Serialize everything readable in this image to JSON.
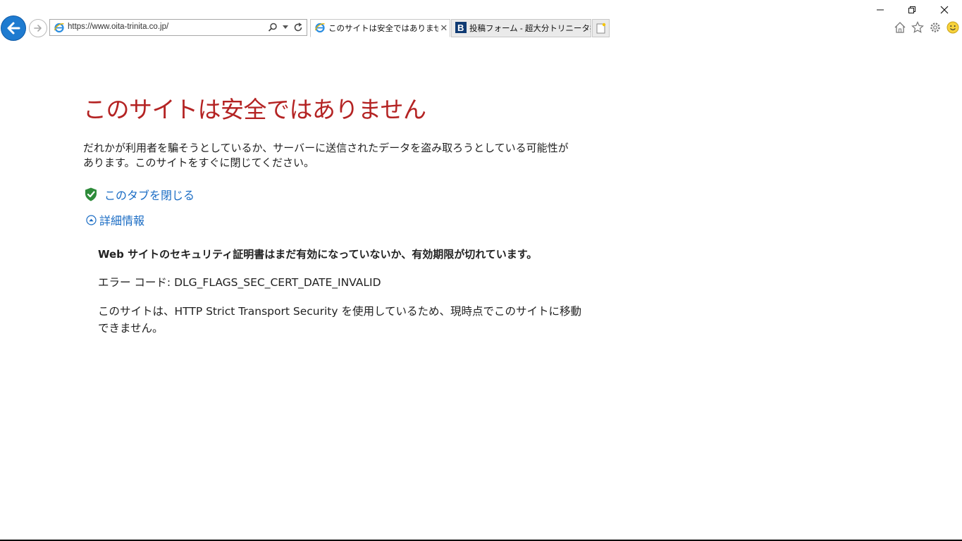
{
  "browser": {
    "address": {
      "url": "https://www.oita-trinita.co.jp/"
    },
    "tabs": [
      {
        "label": "このサイトは安全ではありません",
        "active": true,
        "favicon": "ie-icon"
      },
      {
        "label": "投稿フォーム - 超大分トリニータ掲...",
        "active": false,
        "favicon": "b-favicon"
      }
    ],
    "close_tab_glyph": "✕",
    "accent_color": "#1e7bd0"
  },
  "page": {
    "title": "このサイトは安全ではありません",
    "description": "だれかが利用者を騙そうとしているか、サーバーに送信されたデータを盗み取ろうとしている可能性があります。このサイトをすぐに閉じてください。",
    "close_tab_link": "このタブを閉じる",
    "details_toggle": "詳細情報",
    "details": {
      "headline": "Web サイトのセキュリティ証明書はまだ有効になっていないか、有効期限が切れています。",
      "error_code": "エラー コード: DLG_FLAGS_SEC_CERT_DATE_INVALID",
      "hsts_note": "このサイトは、HTTP Strict Transport Security を使用しているため、現時点でこのサイトに移動できません。"
    },
    "title_color": "#b42323",
    "link_color": "#1a6cc4"
  }
}
